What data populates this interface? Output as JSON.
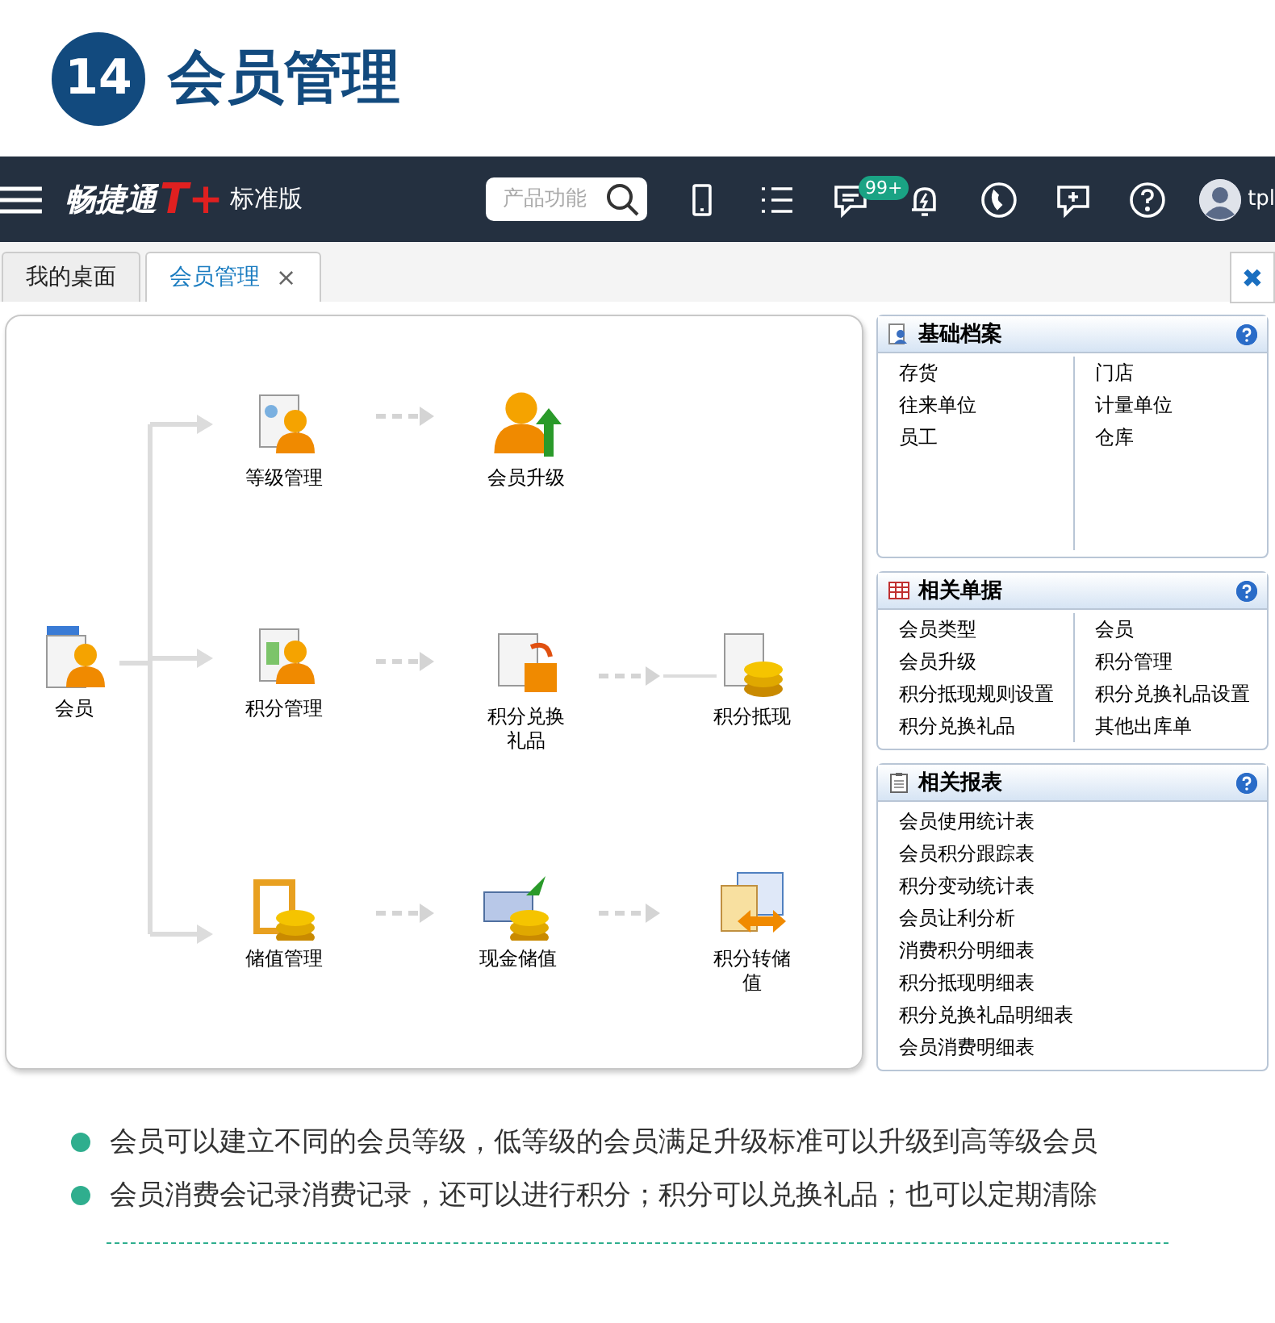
{
  "header": {
    "number": "14",
    "title": "会员管理"
  },
  "topbar": {
    "logo": "畅捷通",
    "logo_mark": "T+",
    "edition": "标准版",
    "search": {
      "placeholder": "产品功能"
    },
    "badge": "99+",
    "user": "tpl"
  },
  "tabs": [
    {
      "label": "我的桌面",
      "selected": false
    },
    {
      "label": "会员管理",
      "selected": true,
      "close": "×"
    }
  ],
  "close_all": "✖",
  "flow": {
    "nodes": [
      {
        "label": "等级管理",
        "kind": "grade"
      },
      {
        "label": "会员升级",
        "kind": "upgrade"
      },
      {
        "label": "会员",
        "kind": "member"
      },
      {
        "label": "积分管理",
        "kind": "points"
      },
      {
        "label": "积分兑换礼品",
        "kind": "gift"
      },
      {
        "label": "积分抵现",
        "kind": "cashout"
      },
      {
        "label": "储值管理",
        "kind": "stored"
      },
      {
        "label": "现金储值",
        "kind": "cash"
      },
      {
        "label": "积分转储值",
        "kind": "transfer"
      }
    ]
  },
  "panels": [
    {
      "title": "基础档案",
      "kind": "archive",
      "items": [
        "存货",
        "往来单位",
        "员工",
        "门店",
        "计量单位",
        "仓库"
      ]
    },
    {
      "title": "相关单据",
      "kind": "documents",
      "items": [
        "会员类型",
        "会员升级",
        "积分抵现规则设置",
        "积分兑换礼品",
        "会员",
        "积分管理",
        "积分兑换礼品设置",
        "其他出库单"
      ]
    },
    {
      "title": "相关报表",
      "kind": "reports",
      "items": [
        "会员使用统计表",
        "会员积分跟踪表",
        "积分变动统计表",
        "会员让利分析",
        "消费积分明细表",
        "积分抵现明细表",
        "积分兑换礼品明细表",
        "会员消费明细表"
      ]
    }
  ],
  "bullets": [
    "会员可以建立不同的会员等级，低等级的会员满足升级标准可以升级到高等级会员",
    "会员消费会记录消费记录，还可以进行积分；积分可以兑换礼品；也可以定期清除"
  ]
}
